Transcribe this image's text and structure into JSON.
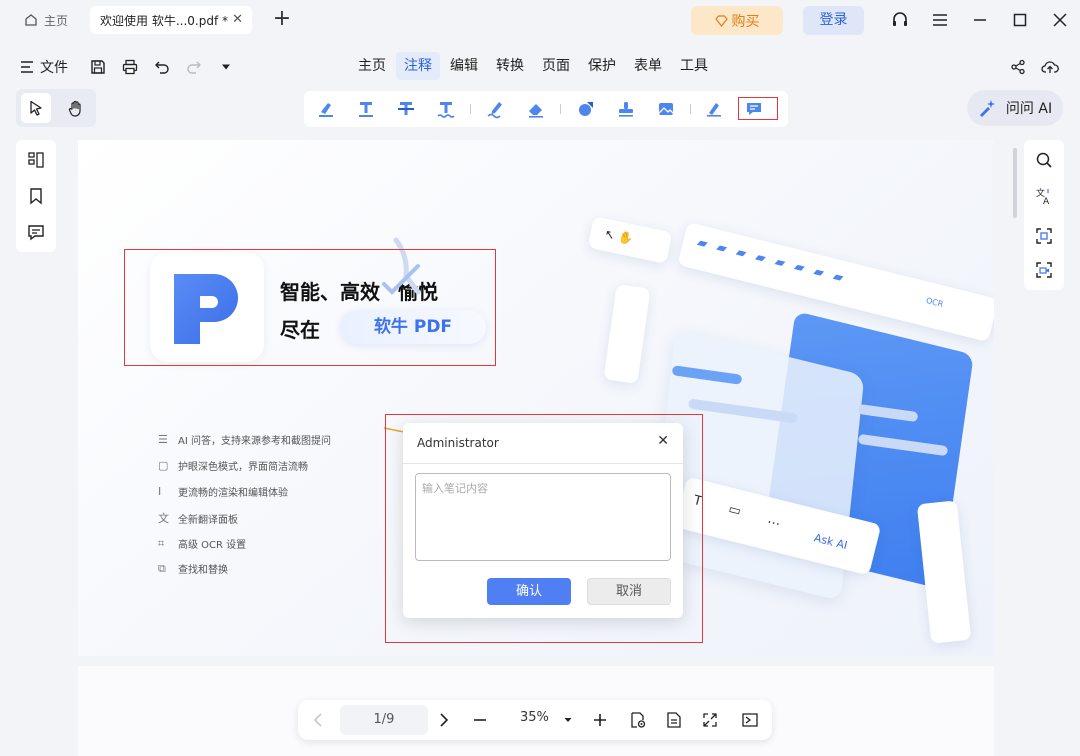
{
  "tabs": {
    "home_label": "主页",
    "doc_label": "欢迎使用 软牛...0.pdf *"
  },
  "title_actions": {
    "buy_label": "购买",
    "login_label": "登录"
  },
  "menu": {
    "file_label": "文件",
    "tabs": [
      "主页",
      "注释",
      "编辑",
      "转换",
      "页面",
      "保护",
      "表单",
      "工具"
    ],
    "active_tab": "注释"
  },
  "ask_ai": {
    "label": "问问 AI"
  },
  "page_content": {
    "headline_line1": "智能、高效",
    "headline_line1b": "愉悦",
    "headline_line2": "尽在",
    "brand": "软牛 PDF",
    "features": [
      "AI 问答，支持来源参考和截图提问",
      "护眼深色模式，界面简洁流畅",
      "更流畅的渲染和编辑体验",
      "全新翻译面板",
      "高级 OCR 设置",
      "查找和替换"
    ],
    "illustration_ask_ai": "Ask AI",
    "illustration_ocr": "OCR"
  },
  "note_popup": {
    "author": "Administrator",
    "placeholder": "输入笔记内容",
    "confirm_label": "确认",
    "cancel_label": "取消"
  },
  "bottom_nav": {
    "page_indicator": "1/9",
    "zoom_level": "35%"
  },
  "colors": {
    "accent": "#2c63d8",
    "highlight_red": "#e23a3a",
    "buy_orange": "#e47d12"
  }
}
